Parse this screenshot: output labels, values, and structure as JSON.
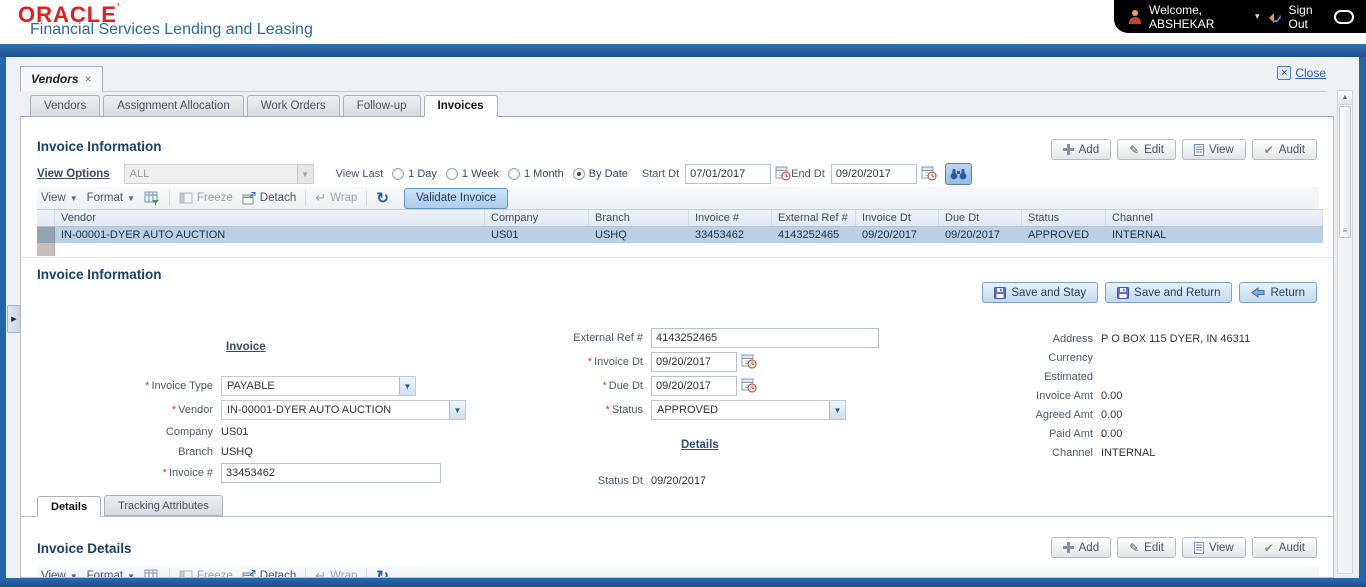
{
  "header": {
    "brand": "ORACLE",
    "product": "Financial Services Lending and Leasing",
    "welcome": "Welcome, ABSHEKAR",
    "sign_out": "Sign Out"
  },
  "window_tab": {
    "label": "Vendors",
    "close": "Close"
  },
  "nav_tabs": {
    "items": [
      "Vendors",
      "Assignment Allocation",
      "Work Orders",
      "Follow-up",
      "Invoices"
    ],
    "active": "Invoices"
  },
  "crud": {
    "add": "Add",
    "edit": "Edit",
    "view": "View",
    "audit": "Audit"
  },
  "toolbar": {
    "view": "View",
    "format": "Format",
    "freeze": "Freeze",
    "detach": "Detach",
    "wrap": "Wrap"
  },
  "search": {
    "title": "Invoice Information",
    "view_options_label": "View Options",
    "view_options_value": "ALL",
    "view_last_label": "View Last",
    "options": [
      "1 Day",
      "1 Week",
      "1 Month",
      "By Date"
    ],
    "selected_option": "By Date",
    "start_dt_label": "Start Dt",
    "start_dt": "07/01/2017",
    "end_dt_label": "End Dt",
    "end_dt": "09/20/2017",
    "validate_button": "Validate Invoice"
  },
  "invoice_table": {
    "columns": [
      "Vendor",
      "Company",
      "Branch",
      "Invoice #",
      "External Ref #",
      "Invoice Dt",
      "Due Dt",
      "Status",
      "Channel"
    ],
    "row": {
      "vendor": "IN-00001-DYER AUTO AUCTION",
      "company": "US01",
      "branch": "USHQ",
      "invoice_no": "33453462",
      "external_ref": "4143252465",
      "invoice_dt": "09/20/2017",
      "due_dt": "09/20/2017",
      "status": "APPROVED",
      "channel": "INTERNAL"
    }
  },
  "form": {
    "title": "Invoice Information",
    "required_marker": "*",
    "save_and_stay": "Save and Stay",
    "save_and_return": "Save and Return",
    "return": "Return",
    "invoice_group": {
      "heading": "Invoice",
      "invoice_type_label": "Invoice Type",
      "invoice_type": "PAYABLE",
      "vendor_label": "Vendor",
      "vendor": "IN-00001-DYER AUTO AUCTION",
      "company_label": "Company",
      "company": "US01",
      "branch_label": "Branch",
      "branch": "USHQ",
      "invoice_no_label": "Invoice #",
      "invoice_no": "33453462",
      "external_ref_label": "External Ref #",
      "external_ref": "4143252465",
      "invoice_dt_label": "Invoice Dt",
      "invoice_dt": "09/20/2017",
      "due_dt_label": "Due Dt",
      "due_dt": "09/20/2017",
      "status_label": "Status",
      "status": "APPROVED"
    },
    "details_group": {
      "heading": "Details",
      "status_dt_label": "Status Dt",
      "status_dt": "09/20/2017"
    },
    "summary": {
      "address_label": "Address",
      "address": "P O BOX 115 DYER, IN 46311",
      "currency_label": "Currency",
      "currency": "",
      "estimated_label": "Estimated",
      "estimated": "",
      "invoice_amt_label": "Invoice Amt",
      "invoice_amt": "0.00",
      "agreed_amt_label": "Agreed Amt",
      "agreed_amt": "0.00",
      "paid_amt_label": "Paid Amt",
      "paid_amt": "0.00",
      "channel_label": "Channel",
      "channel": "INTERNAL"
    }
  },
  "detail_tabs": {
    "details": "Details",
    "tracking": "Tracking Attributes",
    "active": "Details"
  },
  "details_section": {
    "title": "Invoice Details"
  },
  "icons": {
    "dropdown_arrow": "▼",
    "caret_down": "▾",
    "close_x": "×",
    "tab_x": "×",
    "collapse_right": "▶",
    "grip": "≡",
    "scroll_up": "▲",
    "pencil": "✎",
    "check": "✔",
    "wrap_arrow": "↵",
    "refresh": "↻"
  },
  "colors": {
    "oracle_red": "#e0201e",
    "brand_blue": "#2d6a9f",
    "frame_blue": "#2166ab",
    "heading_navy": "#1a4066",
    "selected_row": "#b9d0e6"
  }
}
